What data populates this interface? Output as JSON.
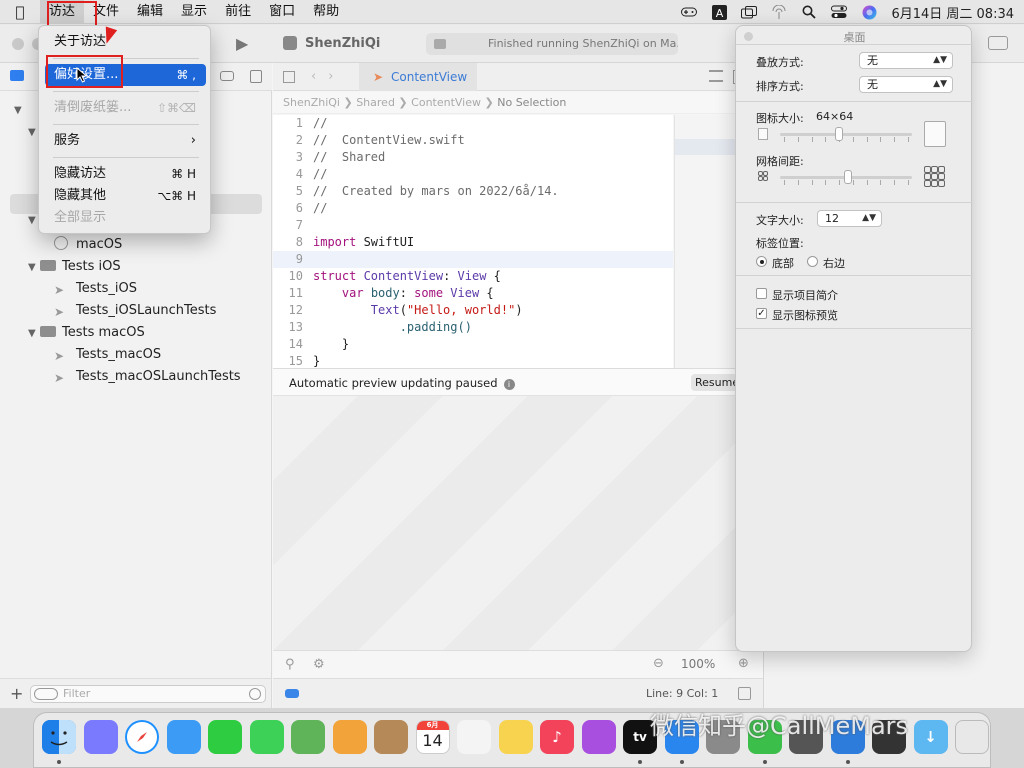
{
  "menubar": {
    "items": [
      "访达",
      "文件",
      "编辑",
      "显示",
      "前往",
      "窗口",
      "帮助"
    ],
    "clock": "6月14日 周二  08:34",
    "status_icons": [
      "game-controller-icon",
      "input-method-icon",
      "screen-mirror-icon",
      "airdrop-icon",
      "search-icon",
      "control-center-icon",
      "siri-icon"
    ]
  },
  "finder_menu": {
    "about": "关于访达",
    "preferences": "偏好设置...",
    "preferences_shortcut": "⌘ ,",
    "empty_trash": "清倒废纸篓...",
    "empty_trash_shortcut": "⇧⌘⌫",
    "services": "服务",
    "hide": "隐藏访达",
    "hide_shortcut": "⌘ H",
    "hide_others": "隐藏其他",
    "hide_others_shortcut": "⌥⌘ H",
    "show_all": "全部显示"
  },
  "xcode": {
    "project_name": "ShenZhiQi",
    "status": "Finished running ShenZhiQi on Ma...",
    "tab": "ContentView",
    "breadcrumb": [
      "ShenZhiQi",
      "Shared",
      "ContentView",
      "No Selection"
    ],
    "preview_status": "Automatic preview updating paused",
    "resume": "Resume",
    "zoom": "100%",
    "cursor_position": "Line: 9  Col: 1",
    "filter_placeholder": "Filter"
  },
  "navigator": {
    "items": [
      {
        "label": "macOS",
        "kind": "gear"
      },
      {
        "label": "Tests iOS",
        "kind": "folder"
      },
      {
        "label": "Tests_iOS",
        "kind": "swift"
      },
      {
        "label": "Tests_iOSLaunchTests",
        "kind": "swift"
      },
      {
        "label": "Tests macOS",
        "kind": "folder"
      },
      {
        "label": "Tests_macOS",
        "kind": "swift"
      },
      {
        "label": "Tests_macOSLaunchTests",
        "kind": "swift"
      }
    ]
  },
  "code": {
    "line_numbers": [
      "1",
      "2",
      "3",
      "4",
      "5",
      "6",
      "7",
      "8",
      "9",
      "10",
      "11",
      "12",
      "13",
      "14",
      "15"
    ],
    "line1": "//",
    "line2": "//  ContentView.swift",
    "line3": "//  Shared",
    "line4": "//",
    "line5": "//  Created by mars on 2022/6å/14.",
    "line6": "//",
    "line8_kw": "import",
    "line8_rest": " SwiftUI",
    "line10_kw": "struct",
    "line10_type": " ContentView",
    "line10_colon": ": ",
    "line10_type2": "View",
    "line10_brace": " {",
    "line11_kw": "var",
    "line11_name": " body",
    "line11_colon": ": ",
    "line11_kw2": "some",
    "line11_type": " View",
    "line11_brace": " {",
    "line12_fn": "Text",
    "line12_open": "(",
    "line12_str": "\"Hello, world!\"",
    "line12_close": ")",
    "line13": ".padding()",
    "line14": "}",
    "line15": "}"
  },
  "desktop_panel": {
    "title": "桌面",
    "stack_label": "叠放方式:",
    "stack_value": "无",
    "sort_label": "排序方式:",
    "sort_value": "无",
    "icon_size_label": "图标大小:",
    "icon_size_value": "64×64",
    "icon_size_fraction": 0.44,
    "grid_spacing_label": "网格间距:",
    "grid_spacing_fraction": 0.52,
    "text_size_label": "文字大小:",
    "text_size_value": "12",
    "label_position_label": "标签位置:",
    "label_bottom": "底部",
    "label_right": "右边",
    "show_item_info": "显示项目简介",
    "show_icon_preview": "显示图标预览",
    "show_item_info_checked": false,
    "show_icon_preview_checked": true
  },
  "dock": {
    "apps": [
      {
        "name": "finder-icon",
        "color": "#2a8cf0"
      },
      {
        "name": "launchpad-icon",
        "color": "#7a7aff"
      },
      {
        "name": "safari-icon",
        "color": "#1e90ff"
      },
      {
        "name": "mail-icon",
        "color": "#3b9bf5"
      },
      {
        "name": "facetime-icon",
        "color": "#2ecc40"
      },
      {
        "name": "messages-icon",
        "color": "#3ed158"
      },
      {
        "name": "maps-icon",
        "color": "#5fb45a"
      },
      {
        "name": "photos-icon",
        "color": "#f2a33a"
      },
      {
        "name": "contacts-icon",
        "color": "#b58a58"
      },
      {
        "name": "calendar-icon",
        "color": "#ffffff"
      },
      {
        "name": "reminders-icon",
        "color": "#f4f4f4"
      },
      {
        "name": "notes-icon",
        "color": "#f7d34f"
      },
      {
        "name": "music-icon",
        "color": "#f2435b"
      },
      {
        "name": "podcasts-icon",
        "color": "#a84fe0"
      },
      {
        "name": "apple-tv-icon",
        "color": "#111111"
      },
      {
        "name": "app-store-icon",
        "color": "#2a86ef"
      },
      {
        "name": "system-preferences-icon",
        "color": "#8a8a8a"
      },
      {
        "name": "wechat-icon",
        "color": "#3cbf4a"
      },
      {
        "name": "screenshot-icon",
        "color": "#555555"
      },
      {
        "name": "xcode-icon",
        "color": "#2d7cdb"
      },
      {
        "name": "instruments-icon",
        "color": "#333333"
      },
      {
        "name": "downloads-folder-icon",
        "color": "#5db7f0"
      },
      {
        "name": "trash-icon",
        "color": "#e8e8e8"
      }
    ],
    "calendar_month": "6月",
    "calendar_day": "14",
    "tv_label": "tv"
  },
  "watermark": "微信知乎@CallMeMars"
}
